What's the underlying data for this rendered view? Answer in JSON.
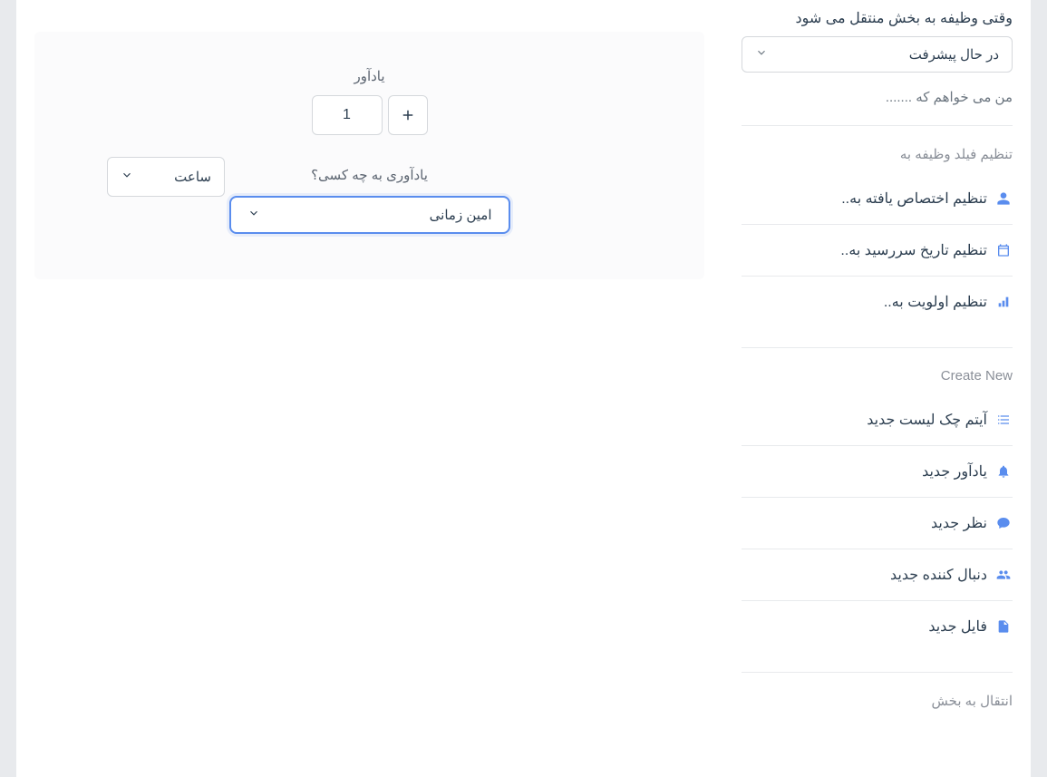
{
  "sidebar": {
    "trigger_label": "وقتی وظیفه به بخش منتقل می شود",
    "status_select_value": "در حال پیشرفت",
    "hint": "من می خواهم که .......",
    "section_field_title": "تنظیم فیلد وظیفه به",
    "field_actions": {
      "assign": "تنظیم اختصاص یافته به..",
      "due": "تنظیم تاریخ سررسید به..",
      "priority": "تنظیم اولویت به.."
    },
    "section_create_title": "Create New",
    "create_actions": {
      "checklist": "آیتم چک لیست جدید",
      "reminder": "یادآور جدید",
      "comment": "نظر جدید",
      "follower": "دنبال کننده جدید",
      "file": "فایل جدید"
    },
    "section_move_title": "انتقال به بخش"
  },
  "main": {
    "reminder_label": "یادآور",
    "reminder_value": "1",
    "unit_label": "ساعت",
    "who_label": "یادآوری به چه کسی؟",
    "person_value": "امین زمانی"
  }
}
